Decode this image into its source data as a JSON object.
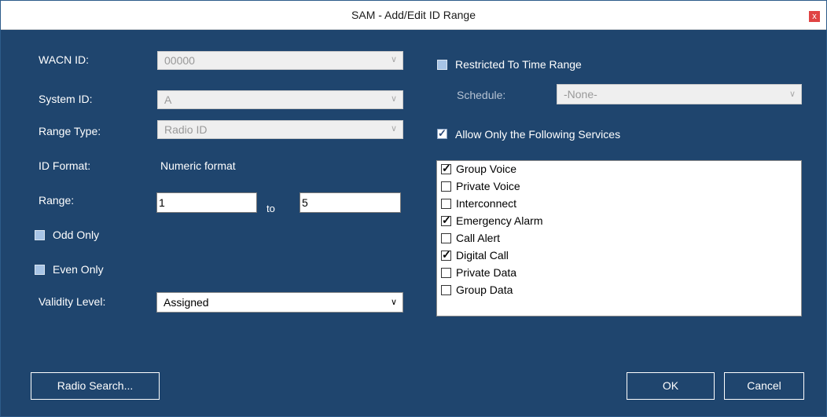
{
  "window": {
    "title": "SAM - Add/Edit ID Range",
    "close_glyph": "x"
  },
  "left": {
    "wacn": {
      "label": "WACN ID:",
      "value": "00000"
    },
    "system": {
      "label": "System ID:",
      "value": "A"
    },
    "range_type": {
      "label": "Range Type:",
      "value": "Radio ID"
    },
    "id_format": {
      "label": "ID Format:",
      "value": "Numeric format"
    },
    "range": {
      "label": "Range:",
      "from": "1",
      "to_label": "to",
      "to": "5"
    },
    "odd_only": {
      "label": "Odd Only",
      "checked": false
    },
    "even_only": {
      "label": "Even Only",
      "checked": false
    },
    "validity": {
      "label": "Validity Level:",
      "value": "Assigned"
    }
  },
  "right": {
    "restricted": {
      "label": "Restricted To Time Range",
      "checked": false
    },
    "schedule": {
      "label": "Schedule:",
      "value": "-None-"
    },
    "allow_only": {
      "label": "Allow Only the Following Services",
      "checked": true
    },
    "services": [
      {
        "label": "Group Voice",
        "checked": true
      },
      {
        "label": "Private Voice",
        "checked": false
      },
      {
        "label": "Interconnect",
        "checked": false
      },
      {
        "label": "Emergency Alarm",
        "checked": true
      },
      {
        "label": "Call Alert",
        "checked": false
      },
      {
        "label": "Digital Call",
        "checked": true
      },
      {
        "label": "Private Data",
        "checked": false
      },
      {
        "label": "Group Data",
        "checked": false
      }
    ]
  },
  "buttons": {
    "radio_search": "Radio Search...",
    "ok": "OK",
    "cancel": "Cancel"
  },
  "icons": {
    "dropdown": "chevron-down-icon",
    "close": "close-icon",
    "check": "check-icon"
  },
  "colors": {
    "background": "#1f456e",
    "title_bar": "#ffffff",
    "close": "#e04343"
  }
}
